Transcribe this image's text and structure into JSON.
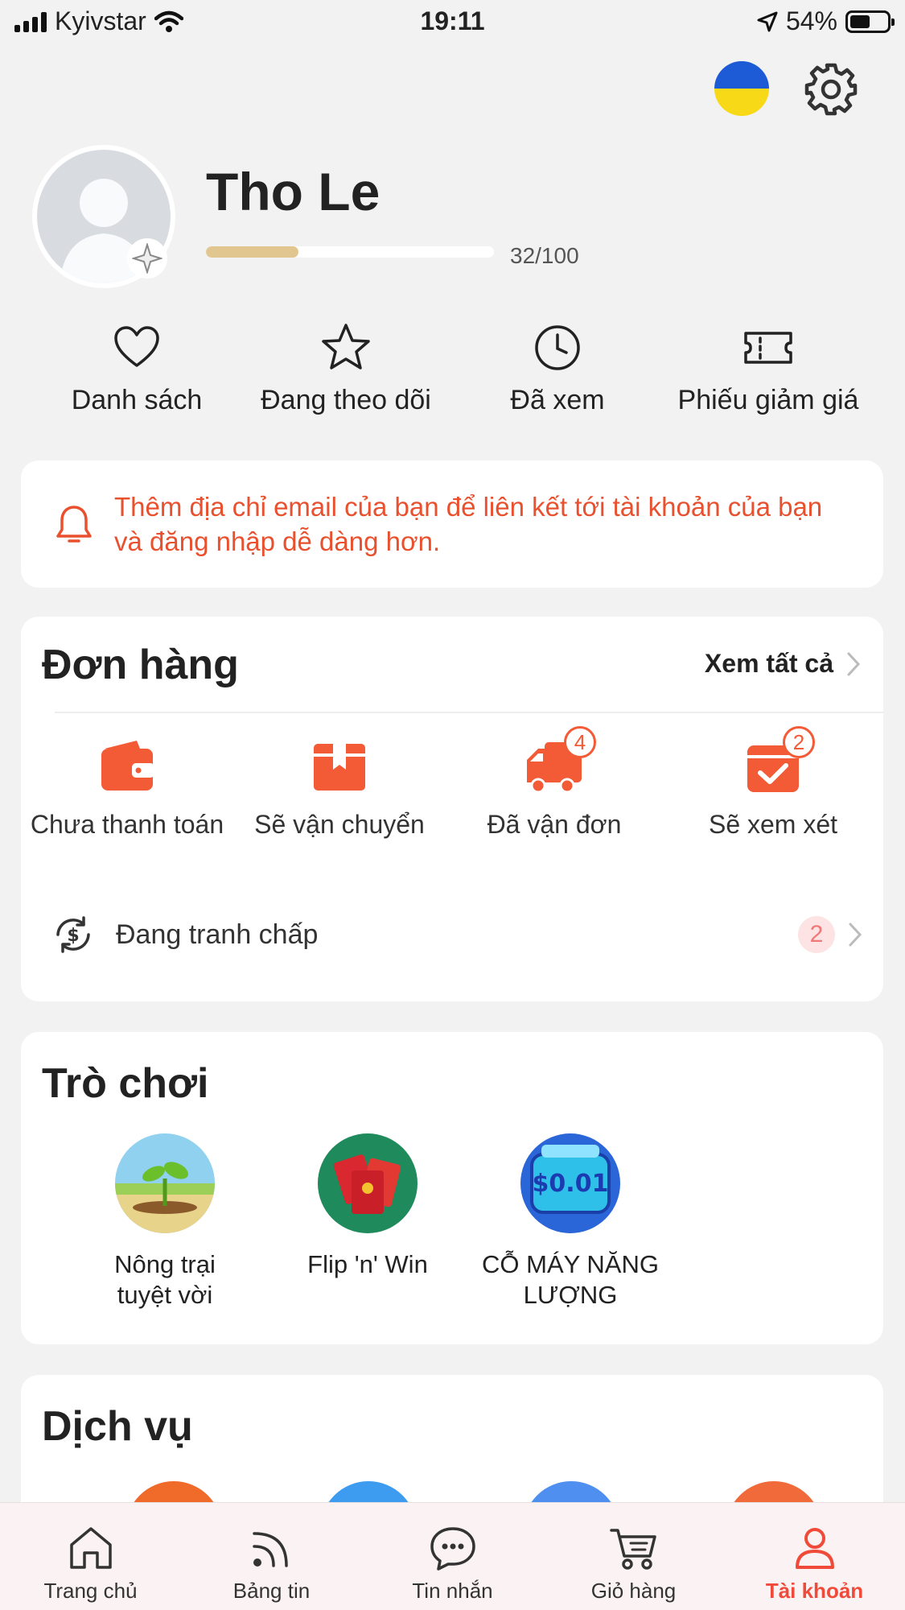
{
  "status_bar": {
    "carrier": "Kyivstar",
    "time": "19:11",
    "battery": "54%"
  },
  "profile": {
    "name": "Tho Le",
    "progress_text": "32/100",
    "progress_fraction": 0.32
  },
  "quick_links": [
    {
      "label": "Danh sách",
      "icon": "heart-icon"
    },
    {
      "label": "Đang theo dõi",
      "icon": "star-icon"
    },
    {
      "label": "Đã xem",
      "icon": "clock-icon"
    },
    {
      "label": "Phiếu giảm giá",
      "icon": "ticket-icon"
    }
  ],
  "alert": {
    "message": "Thêm địa chỉ email của bạn để liên kết tới tài khoản của bạn và đăng nhập dễ dàng hơn."
  },
  "orders": {
    "title": "Đơn hàng",
    "see_all": "Xem tất cả",
    "items": [
      {
        "label": "Chưa thanh toán",
        "icon": "wallet-icon",
        "badge": ""
      },
      {
        "label": "Sẽ vận chuyển",
        "icon": "box-icon",
        "badge": ""
      },
      {
        "label": "Đã vận đơn",
        "icon": "truck-icon",
        "badge": "4"
      },
      {
        "label": "Sẽ xem xét",
        "icon": "review-icon",
        "badge": "2"
      }
    ],
    "dispute": {
      "label": "Đang tranh chấp",
      "count": "2"
    }
  },
  "games": {
    "title": "Trò chơi",
    "items": [
      {
        "label": "Nông trại tuyệt vời"
      },
      {
        "label": "Flip 'n' Win"
      },
      {
        "label": "CỖ MÁY NĂNG LƯỢNG",
        "thumb_text": "$0.01"
      }
    ]
  },
  "services": {
    "title": "Dịch vụ"
  },
  "bottom_nav": [
    {
      "label": "Trang chủ"
    },
    {
      "label": "Bảng tin"
    },
    {
      "label": "Tin nhắn"
    },
    {
      "label": "Giỏ hàng"
    },
    {
      "label": "Tài khoản",
      "active": true
    }
  ],
  "colors": {
    "accent": "#f04b3a",
    "orange": "#f35a36",
    "background": "#f2f2f2"
  }
}
